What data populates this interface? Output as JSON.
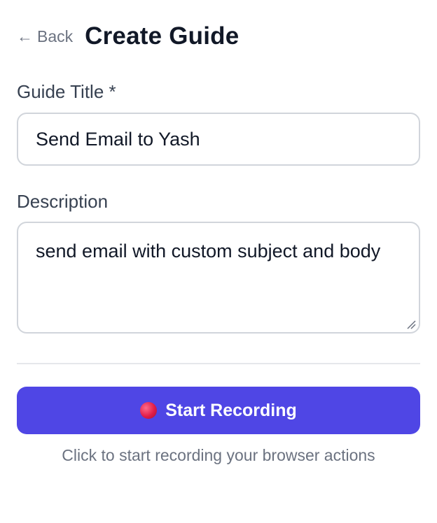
{
  "header": {
    "back_arrow": "←",
    "back_label": "Back",
    "title": "Create Guide"
  },
  "form": {
    "title_label": "Guide Title *",
    "title_value": "Send Email to Yash",
    "description_label": "Description",
    "description_value": "send email with custom subject and body"
  },
  "actions": {
    "record_label": "Start Recording",
    "record_icon": "record-dot-icon",
    "hint": "Click to start recording your browser actions"
  },
  "colors": {
    "accent": "#4f46e5",
    "record_dot": "#e11d48",
    "muted_text": "#6b7280",
    "border": "#d1d5db"
  }
}
